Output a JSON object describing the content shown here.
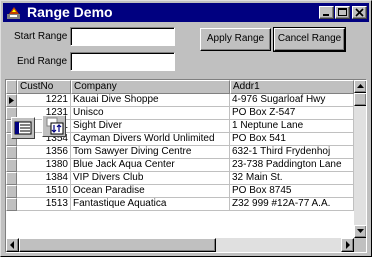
{
  "window": {
    "title": "Range Demo",
    "app_icon": "borland-app-icon",
    "controls": [
      "minimize-icon",
      "maximize-icon",
      "close-icon"
    ]
  },
  "form": {
    "start_range_label": "Start Range",
    "start_range_value": "",
    "end_range_label": "End Range",
    "end_range_value": "",
    "apply_range_label": "Apply Range",
    "cancel_range_label": "Cancel Range"
  },
  "grid": {
    "columns": [
      "CustNo",
      "Company",
      "Addr1"
    ],
    "rows": [
      {
        "custno": "1221",
        "company": "Kauai Dive Shoppe",
        "addr1": "4-976 Sugarloaf Hwy",
        "current": true
      },
      {
        "custno": "1231",
        "company": "Unisco",
        "addr1": "PO Box Z-547"
      },
      {
        "custno": "1351",
        "company": "Sight Diver",
        "addr1": "1 Neptune Lane"
      },
      {
        "custno": "1354",
        "company": "Cayman Divers World Unlimited",
        "addr1": "PO Box 541"
      },
      {
        "custno": "1356",
        "company": "Tom Sawyer Diving Centre",
        "addr1": "632-1 Third Frydenhoj"
      },
      {
        "custno": "1380",
        "company": "Blue Jack Aqua Center",
        "addr1": "23-738 Paddington Lane"
      },
      {
        "custno": "1384",
        "company": "VIP Divers Club",
        "addr1": "32 Main St."
      },
      {
        "custno": "1510",
        "company": "Ocean Paradise",
        "addr1": "PO Box 8745"
      },
      {
        "custno": "1513",
        "company": "Fantastique Aquatica",
        "addr1": "Z32 999 #12A-77 A.A."
      }
    ]
  },
  "floating_icons": [
    "table-component-icon",
    "sort-component-icon"
  ]
}
